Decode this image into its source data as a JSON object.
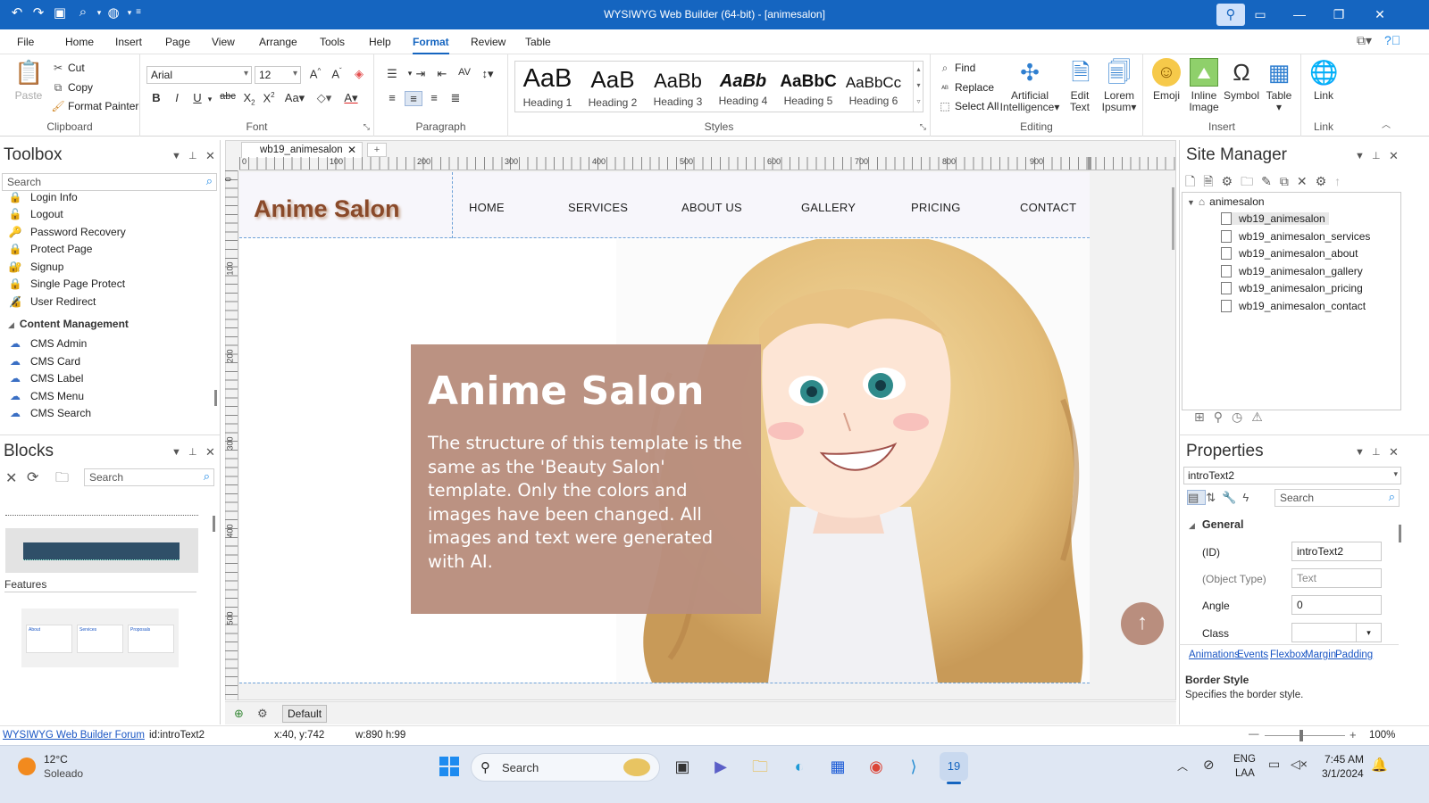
{
  "titlebar": {
    "title": "WYSIWYG Web Builder (64-bit) - [animesalon]"
  },
  "menu": [
    "File",
    "Home",
    "Insert",
    "Page",
    "View",
    "Arrange",
    "Tools",
    "Help",
    "Format",
    "Review",
    "Table"
  ],
  "ribbon": {
    "clipboard": {
      "paste": "Paste",
      "cut": "Cut",
      "copy": "Copy",
      "format_painter": "Format Painter",
      "label": "Clipboard"
    },
    "font": {
      "family": "Arial",
      "size": "12",
      "label": "Font"
    },
    "paragraph": {
      "label": "Paragraph"
    },
    "styles": {
      "items": [
        {
          "sample": "AaB",
          "name": "Heading 1"
        },
        {
          "sample": "AaB",
          "name": "Heading 2"
        },
        {
          "sample": "AaBb",
          "name": "Heading 3"
        },
        {
          "sample": "AaBb",
          "name": "Heading 4"
        },
        {
          "sample": "AaBbC",
          "name": "Heading 5"
        },
        {
          "sample": "AaBbCc",
          "name": "Heading 6"
        }
      ],
      "label": "Styles"
    },
    "editing": {
      "find": "Find",
      "replace": "Replace",
      "select_all": "Select All",
      "ai_line1": "Artificial",
      "ai_line2": "Intelligence",
      "edit_line1": "Edit",
      "edit_line2": "Text",
      "lorem_line1": "Lorem",
      "lorem_line2": "Ipsum",
      "label": "Editing"
    },
    "insert": {
      "emoji": "Emoji",
      "inline_line1": "Inline",
      "inline_line2": "Image",
      "symbol": "Symbol",
      "table": "Table",
      "label": "Insert"
    },
    "link": {
      "link": "Link",
      "label": "Link"
    }
  },
  "toolbox": {
    "title": "Toolbox",
    "search_placeholder": "Search",
    "items": [
      "Login Info",
      "Logout",
      "Password Recovery",
      "Protect Page",
      "Signup",
      "Single Page Protect",
      "User Redirect"
    ],
    "category": "Content Management",
    "cms_items": [
      "CMS Admin",
      "CMS Card",
      "CMS Label",
      "CMS Menu",
      "CMS Search"
    ]
  },
  "blocks": {
    "title": "Blocks",
    "search_placeholder": "Search",
    "features_label": "Features",
    "thumb_labels": [
      "About",
      "Services",
      "Proposals"
    ]
  },
  "document": {
    "tab": "wb19_animesalon",
    "ruler_top": [
      "0",
      "100",
      "200",
      "300",
      "400",
      "500",
      "600",
      "700",
      "800",
      "900"
    ],
    "ruler_left": [
      "0",
      "100",
      "200",
      "300",
      "400",
      "500"
    ],
    "layout_button": "Default"
  },
  "site": {
    "logo": "Anime Salon",
    "nav": [
      "HOME",
      "SERVICES",
      "ABOUT US",
      "GALLERY",
      "PRICING",
      "CONTACT"
    ],
    "intro_title": "Anime Salon",
    "intro_text": "The structure of this template is the same as the 'Beauty Salon' template. Only the colors and images have been changed. All images and text were generated with AI.",
    "scroll_icon": "↑"
  },
  "site_manager": {
    "title": "Site Manager",
    "root": "animesalon",
    "pages": [
      "wb19_animesalon",
      "wb19_animesalon_services",
      "wb19_animesalon_about",
      "wb19_animesalon_gallery",
      "wb19_animesalon_pricing",
      "wb19_animesalon_contact"
    ]
  },
  "properties": {
    "title": "Properties",
    "object": "introText2",
    "search_placeholder": "Search",
    "section": "General",
    "rows": [
      {
        "label": "(ID)",
        "value": "introText2"
      },
      {
        "label": "(Object Type)",
        "value": "Text"
      },
      {
        "label": "Angle",
        "value": "0"
      },
      {
        "label": "Class",
        "value": ""
      }
    ],
    "links": [
      "Animations",
      "Events",
      "Flexbox",
      "Margin",
      "Padding"
    ],
    "help_title": "Border Style",
    "help_text": "Specifies the border style."
  },
  "statusbar": {
    "forum": "WYSIWYG Web Builder Forum",
    "id": "id:introText2",
    "pos": "x:40, y:742",
    "size": "w:890 h:99",
    "zoom": "100%"
  },
  "taskbar": {
    "weather_temp": "12°C",
    "weather_desc": "Soleado",
    "search": "Search",
    "lang1": "ENG",
    "lang2": "LAA",
    "time": "7:45 AM",
    "date": "3/1/2024"
  },
  "colors": {
    "accent": "#1565c0",
    "salon_box": "#b98e7e",
    "logo": "#8a4a2a"
  }
}
